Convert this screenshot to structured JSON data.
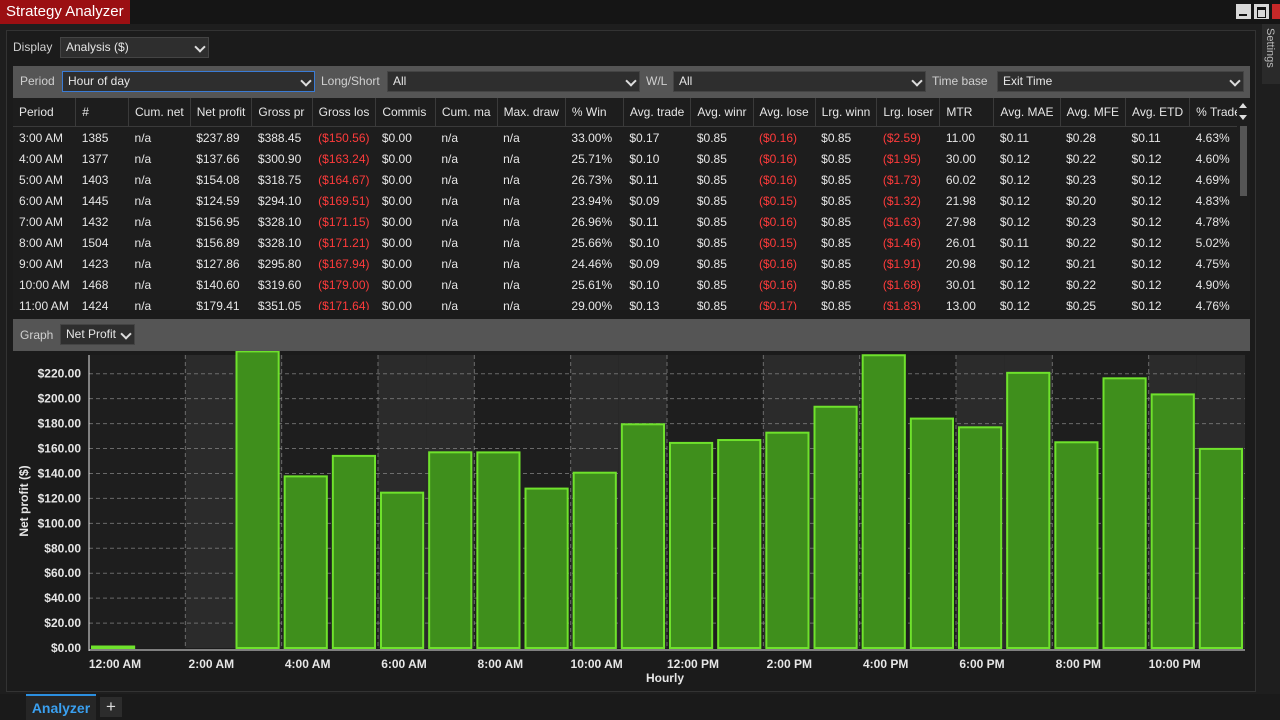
{
  "window": {
    "title": "Strategy Analyzer",
    "side_tab": "Settings"
  },
  "display": {
    "label": "Display",
    "value": "Analysis ($)"
  },
  "filters": {
    "period_label": "Period",
    "period_value": "Hour of day",
    "longshort_label": "Long/Short",
    "longshort_value": "All",
    "wl_label": "W/L",
    "wl_value": "All",
    "timebase_label": "Time base",
    "timebase_value": "Exit Time"
  },
  "table": {
    "columns": [
      "Period",
      "#",
      "Cum. net",
      "Net profit",
      "Gross pr",
      "Gross los",
      "Commis",
      "Cum. ma",
      "Max. draw",
      "% Win",
      "Avg. trade",
      "Avg. winr",
      "Avg. lose",
      "Lrg. winn",
      "Lrg. loser",
      "MTR",
      "Avg. MAE",
      "Avg. MFE",
      "Avg. ETD",
      "% Trade"
    ],
    "rows": [
      [
        "3:00 AM",
        "1385",
        "n/a",
        "$237.89",
        "$388.45",
        "($150.56)",
        "$0.00",
        "n/a",
        "n/a",
        "33.00%",
        "$0.17",
        "$0.85",
        "($0.16)",
        "$0.85",
        "($2.59)",
        "11.00",
        "$0.11",
        "$0.28",
        "$0.11",
        "4.63%"
      ],
      [
        "4:00 AM",
        "1377",
        "n/a",
        "$137.66",
        "$300.90",
        "($163.24)",
        "$0.00",
        "n/a",
        "n/a",
        "25.71%",
        "$0.10",
        "$0.85",
        "($0.16)",
        "$0.85",
        "($1.95)",
        "30.00",
        "$0.12",
        "$0.22",
        "$0.12",
        "4.60%"
      ],
      [
        "5:00 AM",
        "1403",
        "n/a",
        "$154.08",
        "$318.75",
        "($164.67)",
        "$0.00",
        "n/a",
        "n/a",
        "26.73%",
        "$0.11",
        "$0.85",
        "($0.16)",
        "$0.85",
        "($1.73)",
        "60.02",
        "$0.12",
        "$0.23",
        "$0.12",
        "4.69%"
      ],
      [
        "6:00 AM",
        "1445",
        "n/a",
        "$124.59",
        "$294.10",
        "($169.51)",
        "$0.00",
        "n/a",
        "n/a",
        "23.94%",
        "$0.09",
        "$0.85",
        "($0.15)",
        "$0.85",
        "($1.32)",
        "21.98",
        "$0.12",
        "$0.20",
        "$0.12",
        "4.83%"
      ],
      [
        "7:00 AM",
        "1432",
        "n/a",
        "$156.95",
        "$328.10",
        "($171.15)",
        "$0.00",
        "n/a",
        "n/a",
        "26.96%",
        "$0.11",
        "$0.85",
        "($0.16)",
        "$0.85",
        "($1.63)",
        "27.98",
        "$0.12",
        "$0.23",
        "$0.12",
        "4.78%"
      ],
      [
        "8:00 AM",
        "1504",
        "n/a",
        "$156.89",
        "$328.10",
        "($171.21)",
        "$0.00",
        "n/a",
        "n/a",
        "25.66%",
        "$0.10",
        "$0.85",
        "($0.15)",
        "$0.85",
        "($1.46)",
        "26.01",
        "$0.11",
        "$0.22",
        "$0.12",
        "5.02%"
      ],
      [
        "9:00 AM",
        "1423",
        "n/a",
        "$127.86",
        "$295.80",
        "($167.94)",
        "$0.00",
        "n/a",
        "n/a",
        "24.46%",
        "$0.09",
        "$0.85",
        "($0.16)",
        "$0.85",
        "($1.91)",
        "20.98",
        "$0.12",
        "$0.21",
        "$0.12",
        "4.75%"
      ],
      [
        "10:00 AM",
        "1468",
        "n/a",
        "$140.60",
        "$319.60",
        "($179.00)",
        "$0.00",
        "n/a",
        "n/a",
        "25.61%",
        "$0.10",
        "$0.85",
        "($0.16)",
        "$0.85",
        "($1.68)",
        "30.01",
        "$0.12",
        "$0.22",
        "$0.12",
        "4.90%"
      ],
      [
        "11:00 AM",
        "1424",
        "n/a",
        "$179.41",
        "$351.05",
        "($171.64)",
        "$0.00",
        "n/a",
        "n/a",
        "29.00%",
        "$0.13",
        "$0.85",
        "($0.17)",
        "$0.85",
        "($1.83)",
        "13.00",
        "$0.12",
        "$0.25",
        "$0.12",
        "4.76%"
      ]
    ]
  },
  "graph": {
    "label": "Graph",
    "value": "Net Profit"
  },
  "chart_data": {
    "type": "bar",
    "ylabel": "Net profit ($)",
    "xlabel": "Hourly",
    "ylim": [
      0,
      235
    ],
    "yticks": [
      "$0.00",
      "$20.00",
      "$40.00",
      "$60.00",
      "$80.00",
      "$100.00",
      "$120.00",
      "$140.00",
      "$160.00",
      "$180.00",
      "$200.00",
      "$220.00"
    ],
    "xticks": [
      "12:00 AM",
      "2:00 AM",
      "4:00 AM",
      "6:00 AM",
      "8:00 AM",
      "10:00 AM",
      "12:00 PM",
      "2:00 PM",
      "4:00 PM",
      "6:00 PM",
      "8:00 PM",
      "10:00 PM"
    ],
    "categories": [
      "12 AM",
      "1 AM",
      "2 AM",
      "3 AM",
      "4 AM",
      "5 AM",
      "6 AM",
      "7 AM",
      "8 AM",
      "9 AM",
      "10 AM",
      "11 AM",
      "12 PM",
      "1 PM",
      "2 PM",
      "3 PM",
      "4 PM",
      "5 PM",
      "6 PM",
      "7 PM",
      "8 PM",
      "9 PM",
      "10 PM",
      "11 PM"
    ],
    "values": [
      1.2,
      null,
      null,
      237.89,
      137.66,
      154.08,
      124.59,
      156.95,
      156.89,
      127.86,
      140.6,
      179.41,
      164.5,
      166.8,
      172.7,
      193.5,
      234.8,
      184.0,
      177.0,
      220.7,
      165.0,
      216.3,
      203.4,
      159.7
    ],
    "grid": true,
    "colors": {
      "bar_fill": "#3f8f1c",
      "bar_edge": "#6fe22c",
      "band": "#2b2b2b",
      "plot_bg": "#1e1e1e"
    }
  },
  "bottom_tabs": {
    "active": "Analyzer",
    "add": "+"
  }
}
